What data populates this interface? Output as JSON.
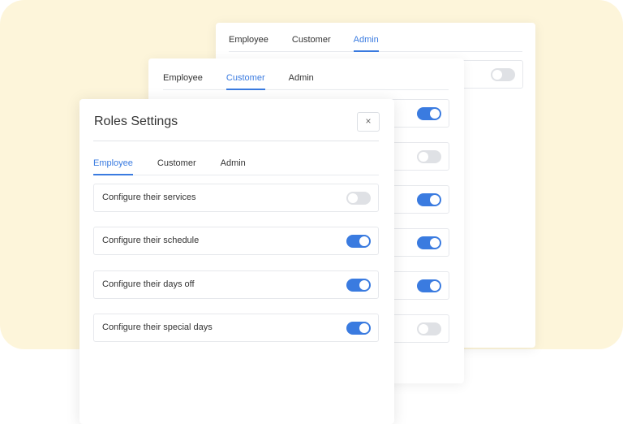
{
  "back_card": {
    "tabs": [
      "Employee",
      "Customer",
      "Admin"
    ],
    "active_tab": "Admin",
    "toggles": [
      false
    ]
  },
  "middle_card": {
    "tabs": [
      "Employee",
      "Customer",
      "Admin"
    ],
    "active_tab": "Customer",
    "toggles": [
      true,
      false,
      true,
      true,
      true,
      false
    ]
  },
  "dialog": {
    "title": "Roles Settings",
    "close_label": "×",
    "tabs": [
      "Employee",
      "Customer",
      "Admin"
    ],
    "active_tab": "Employee",
    "rows": [
      {
        "label": "Configure their services",
        "enabled": false
      },
      {
        "label": "Configure their schedule",
        "enabled": true
      },
      {
        "label": "Configure their days off",
        "enabled": true
      },
      {
        "label": "Configure their special days",
        "enabled": true
      }
    ]
  },
  "colors": {
    "accent": "#3a7be0",
    "background": "#fdf5da"
  }
}
